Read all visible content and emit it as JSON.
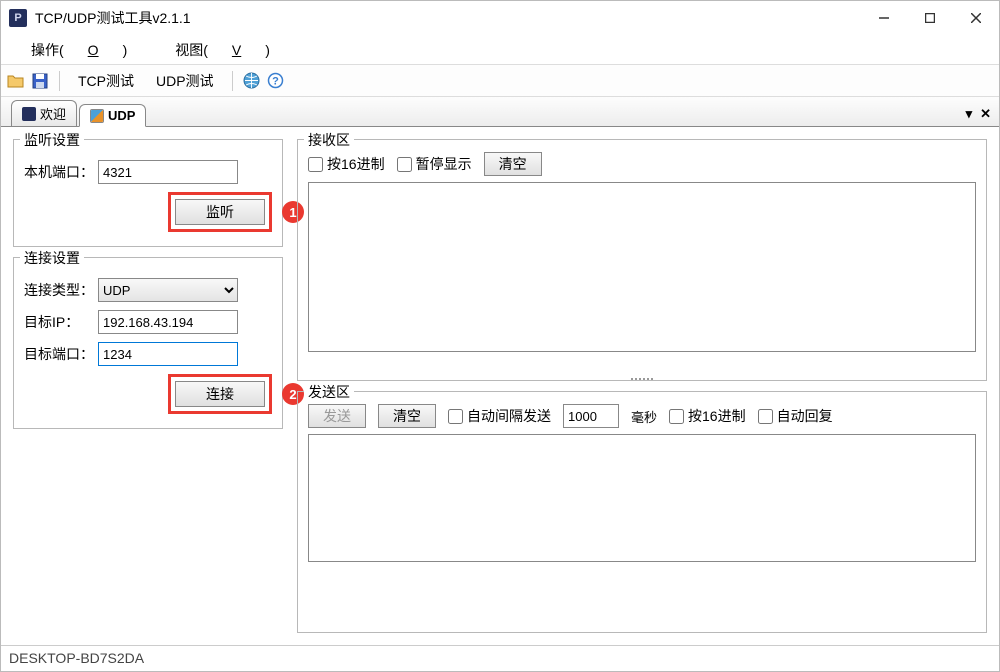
{
  "title": "TCP/UDP测试工具v2.1.1",
  "menu": {
    "operate": "操作(",
    "operate_u": "O",
    "operate2": ")",
    "view": "视图(",
    "view_u": "V",
    "view2": ")"
  },
  "toolbar": {
    "tcp": "TCP测试",
    "udp": "UDP测试"
  },
  "tabs": {
    "welcome": "欢迎",
    "udp": "UDP"
  },
  "listen": {
    "legend": "监听设置",
    "port_label": "本机端口：",
    "port_value": "4321",
    "listen_btn": "监听"
  },
  "connect": {
    "legend": "连接设置",
    "type_label": "连接类型：",
    "type_value": "UDP",
    "ip_label": "目标IP：",
    "ip_value": "192.168.43.194",
    "port_label": "目标端口：",
    "port_value": "1234",
    "connect_btn": "连接"
  },
  "recv": {
    "legend": "接收区",
    "hex": "按16进制",
    "pause": "暂停显示",
    "clear": "清空"
  },
  "send": {
    "legend": "发送区",
    "send_btn": "发送",
    "clear": "清空",
    "auto_interval": "自动间隔发送",
    "interval_value": "1000",
    "ms": "毫秒",
    "hex": "按16进制",
    "auto_reply": "自动回复"
  },
  "annotations": {
    "b1": "1",
    "b2": "2"
  },
  "status": "DESKTOP-BD7S2DA"
}
